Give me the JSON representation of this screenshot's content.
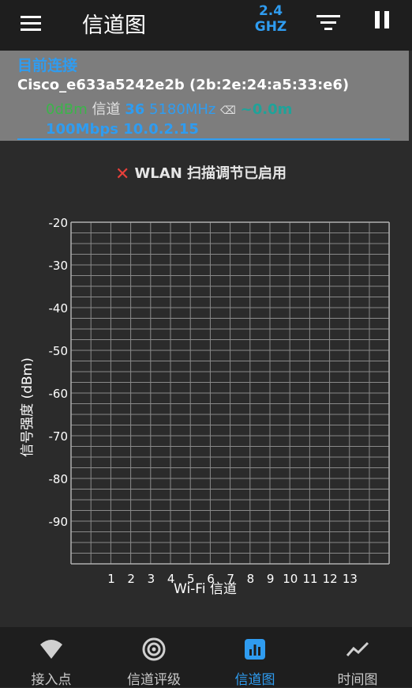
{
  "header": {
    "title": "信道图",
    "band_label": "2.4",
    "band_unit": "GHZ"
  },
  "connection": {
    "heading": "目前连接",
    "ssid_line": "Cisco_e633a5242e2b (2b:2e:24:a5:33:e6)",
    "signal": "0dBm",
    "channel_prefix": "信道",
    "channel": "36",
    "frequency": "5180MHz",
    "distance": "~0.0m",
    "speed_ip": "100Mbps 10.0.2.15"
  },
  "notice": {
    "text": "WLAN 扫描调节已启用"
  },
  "chart_data": {
    "type": "line",
    "xlabel": "Wi-Fi 信道",
    "ylabel": "信号强度 (dBm)",
    "x_ticks": [
      "1",
      "2",
      "3",
      "4",
      "5",
      "6",
      "7",
      "8",
      "9",
      "10",
      "11",
      "12",
      "13"
    ],
    "y_ticks": [
      "-20",
      "-30",
      "-40",
      "-50",
      "-60",
      "-70",
      "-80",
      "-90"
    ],
    "ylim": [
      -100,
      -20
    ],
    "grid": true,
    "series": []
  },
  "nav": {
    "items": [
      {
        "label": "接入点"
      },
      {
        "label": "信道评级"
      },
      {
        "label": "信道图"
      },
      {
        "label": "时间图"
      }
    ]
  },
  "colors": {
    "accent": "#2f9cf0",
    "signal_green": "#3bb54a",
    "teal": "#1fa39a",
    "error_red": "#e8403a"
  }
}
